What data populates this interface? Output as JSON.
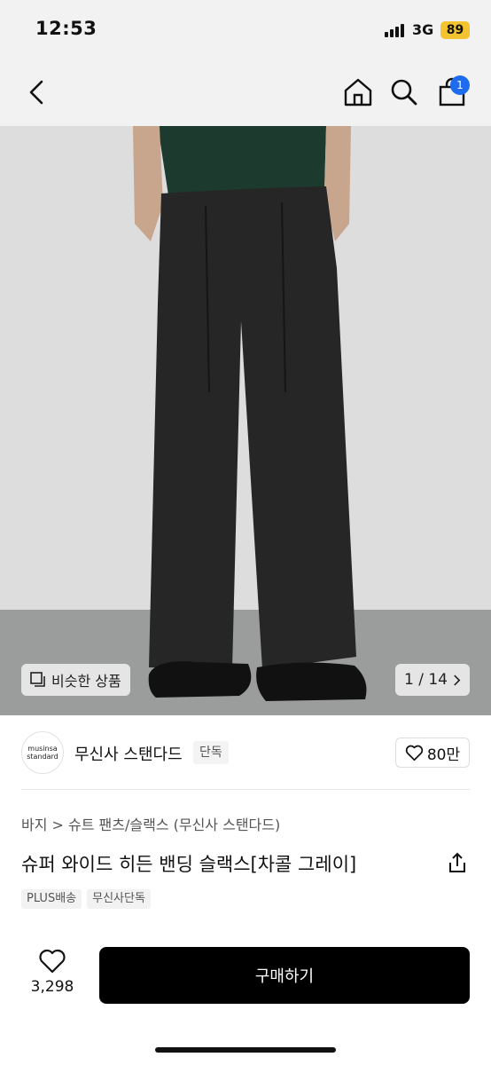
{
  "status_bar": {
    "time": "12:53",
    "network": "3G",
    "battery": "89"
  },
  "nav": {
    "cart_count": "1",
    "icons": [
      "chevron-left-icon",
      "home-icon",
      "search-icon",
      "shopping-bag-icon"
    ]
  },
  "gallery": {
    "similar_label": "비슷한 상품",
    "counter": "1 / 14"
  },
  "brand": {
    "logo_line1": "musinsa",
    "logo_line2": "standard",
    "name": "무신사 스탠다드",
    "tag": "단독",
    "likes": "80만"
  },
  "product": {
    "breadcrumb": "바지 > 슈트 팬츠/슬랙스 (무신사 스탠다드)",
    "title": "슈퍼 와이드 히든 밴딩 슬랙스[차콜 그레이]",
    "tags": [
      "PLUS배송",
      "무신사단독"
    ]
  },
  "bottom_bar": {
    "wish_count": "3,298",
    "buy_label": "구매하기"
  },
  "colors": {
    "badge": "#1e6bf0",
    "battery": "#f4c430",
    "buy_button": "#000000"
  }
}
